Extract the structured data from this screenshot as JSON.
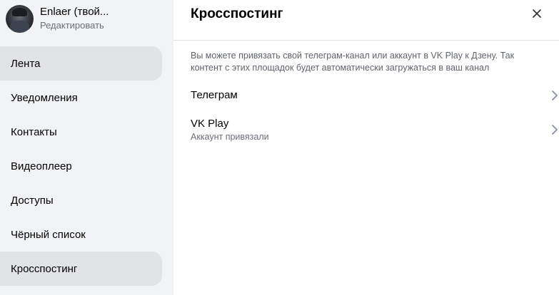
{
  "profile": {
    "name": "Enlaer (твой...",
    "edit_label": "Редактировать"
  },
  "sidebar": {
    "items": [
      {
        "label": "Лента",
        "selected": true
      },
      {
        "label": "Уведомления",
        "selected": false
      },
      {
        "label": "Контакты",
        "selected": false
      },
      {
        "label": "Видеоплеер",
        "selected": false
      },
      {
        "label": "Доступы",
        "selected": false
      },
      {
        "label": "Чёрный список",
        "selected": false
      },
      {
        "label": "Кросспостинг",
        "selected": true
      }
    ]
  },
  "panel": {
    "title": "Кросспостинг",
    "description": "Вы можете привязать свой телеграм-канал или аккаунт в VK Play к Дзену. Так контент с этих площадок будет автоматически загружаться в ваш канал",
    "rows": [
      {
        "title": "Телеграм",
        "subtitle": ""
      },
      {
        "title": "VK Play",
        "subtitle": "Аккаунт привязали"
      }
    ]
  },
  "icons": {
    "close": "close-icon",
    "chevron": "chevron-right-icon"
  }
}
